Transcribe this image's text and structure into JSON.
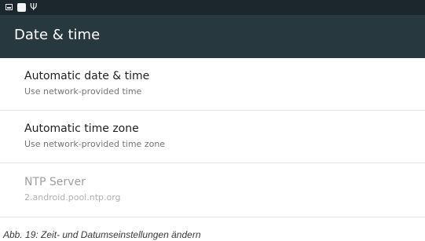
{
  "status_bar": {
    "icons": [
      "picture-notification-icon",
      "square-notification-icon",
      "usb-icon"
    ],
    "usb_glyph": "Ψ"
  },
  "app_bar": {
    "title": "Date & time"
  },
  "preferences": [
    {
      "title": "Automatic date & time",
      "summary": "Use network-provided time",
      "enabled": true
    },
    {
      "title": "Automatic time zone",
      "summary": "Use network-provided time zone",
      "enabled": true
    },
    {
      "title": "NTP Server",
      "summary": "2.android.pool.ntp.org",
      "enabled": false
    }
  ],
  "caption": "Abb. 19: Zeit- und Datumseinstellungen ändern",
  "colors": {
    "status_bar": "#1b272c",
    "app_bar": "#27393f",
    "background": "#ffffff",
    "divider": "#dfe3e5"
  }
}
